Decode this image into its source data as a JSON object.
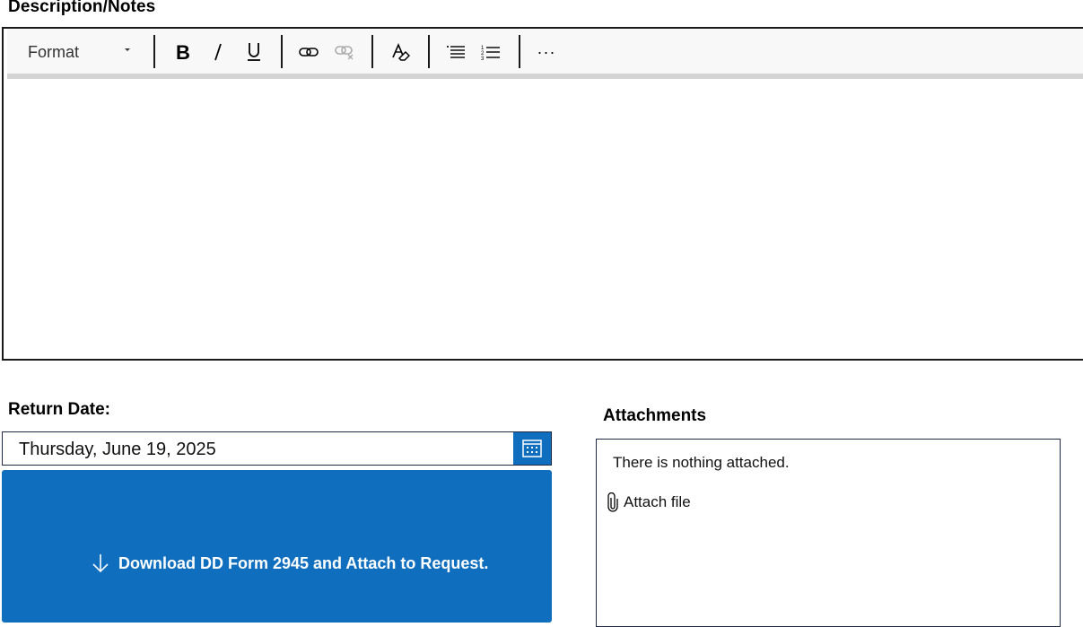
{
  "description": {
    "label": "Description/Notes",
    "body_text": ""
  },
  "toolbar": {
    "format_label": "Format",
    "buttons": [
      {
        "name": "bold",
        "icon": "bold-icon"
      },
      {
        "name": "italic",
        "icon": "italic-icon"
      },
      {
        "name": "underline",
        "icon": "underline-icon"
      },
      {
        "name": "insert-link",
        "icon": "link-icon"
      },
      {
        "name": "remove-link",
        "icon": "unlink-icon",
        "disabled": true
      },
      {
        "name": "clear-formatting",
        "icon": "clear-format-icon"
      },
      {
        "name": "bulleted-list",
        "icon": "bullet-list-icon"
      },
      {
        "name": "numbered-list",
        "icon": "numbered-list-icon"
      },
      {
        "name": "more",
        "icon": "more-icon",
        "label": "···"
      }
    ]
  },
  "return_date": {
    "label": "Return Date:",
    "value": "Thursday, June 19, 2025",
    "calendar_icon": "calendar-icon"
  },
  "download": {
    "label": "Download DD Form 2945 and Attach to Request.",
    "icon": "arrow-down-icon"
  },
  "attachments": {
    "label": "Attachments",
    "empty_text": "There is nothing attached.",
    "attach_label": "Attach file",
    "attach_icon": "paperclip-icon"
  },
  "colors": {
    "accent": "#106ebe",
    "border": "#1e2a44",
    "toolbar_bg": "#f8f8f8",
    "toolbar_rule": "#d4d4d4"
  }
}
